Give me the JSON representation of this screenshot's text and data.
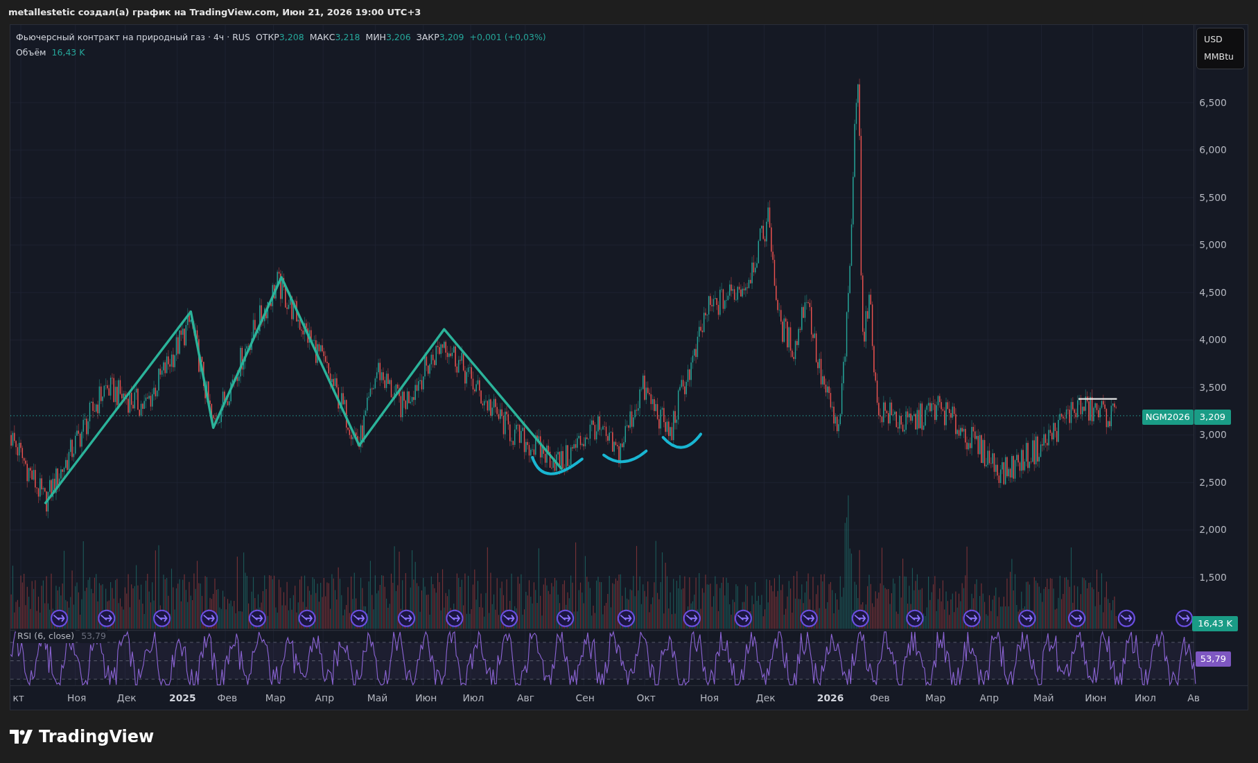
{
  "header": {
    "text": "metallestetic создал(а) график на TradingView.com, Июн 21, 2026 19:00 UTC+3"
  },
  "legend": {
    "title": "Фьючерсный контракт на природный газ · 4ч · RUS",
    "values": [
      {
        "label": "ОТКР",
        "value": "3,208"
      },
      {
        "label": "МАКС",
        "value": "3,218"
      },
      {
        "label": "МИН",
        "value": "3,206"
      },
      {
        "label": "ЗАКР",
        "value": "3,209"
      }
    ],
    "change": "+0,001 (+0,03%)",
    "volume_label": "Объём",
    "volume_value": "16,43 K"
  },
  "currency_box": [
    "USD",
    "MMBtu"
  ],
  "price_axis": [
    "6,500",
    "6,000",
    "5,500",
    "5,000",
    "4,500",
    "4,000",
    "3,500",
    "3,000",
    "2,500",
    "2,000",
    "1,500"
  ],
  "last_price": {
    "symbol": "NGM2026",
    "value": "3,209"
  },
  "volume_badge": "16,43 K",
  "rsi": {
    "label": "RSI (6, close)",
    "legend_value": "53,79",
    "badge": "53,79"
  },
  "time_axis": [
    {
      "label": "кт",
      "kind": "month"
    },
    {
      "label": "Ноя",
      "kind": "month"
    },
    {
      "label": "Дек",
      "kind": "month"
    },
    {
      "label": "2025",
      "kind": "year"
    },
    {
      "label": "Фев",
      "kind": "month"
    },
    {
      "label": "Мар",
      "kind": "month"
    },
    {
      "label": "Апр",
      "kind": "month"
    },
    {
      "label": "Май",
      "kind": "month"
    },
    {
      "label": "Июн",
      "kind": "month"
    },
    {
      "label": "Июл",
      "kind": "month"
    },
    {
      "label": "Авг",
      "kind": "month"
    },
    {
      "label": "Сен",
      "kind": "month"
    },
    {
      "label": "Окт",
      "kind": "month"
    },
    {
      "label": "Ноя",
      "kind": "month"
    },
    {
      "label": "Дек",
      "kind": "month"
    },
    {
      "label": "2026",
      "kind": "year"
    },
    {
      "label": "Фев",
      "kind": "month"
    },
    {
      "label": "Мар",
      "kind": "month"
    },
    {
      "label": "Апр",
      "kind": "month"
    },
    {
      "label": "Май",
      "kind": "month"
    },
    {
      "label": "Июн",
      "kind": "month"
    },
    {
      "label": "Июл",
      "kind": "month"
    },
    {
      "label": "Ав",
      "kind": "month"
    }
  ],
  "footer": {
    "logo_text": "TradingView"
  }
}
